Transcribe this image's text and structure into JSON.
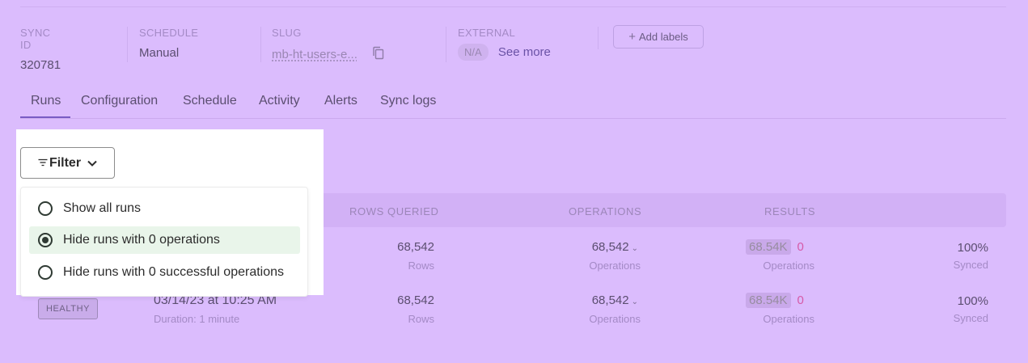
{
  "meta": {
    "sync_id": {
      "label": "SYNC ID",
      "value": "320781"
    },
    "schedule": {
      "label": "SCHEDULE",
      "value": "Manual"
    },
    "slug": {
      "label": "SLUG",
      "value": "mb-ht-users-e..."
    },
    "external": {
      "label": "EXTERNAL",
      "badge": "N/A",
      "link": "See more"
    },
    "add_labels": "Add labels"
  },
  "tabs": [
    "Runs",
    "Configuration",
    "Schedule",
    "Activity",
    "Alerts",
    "Sync logs"
  ],
  "active_tab": "Runs",
  "filter": {
    "button_label": "Filter",
    "options": [
      {
        "label": "Show all runs",
        "selected": false
      },
      {
        "label": "Hide runs with 0 operations",
        "selected": true
      },
      {
        "label": "Hide runs with 0 successful operations",
        "selected": false
      }
    ]
  },
  "table": {
    "headers": {
      "rows_queried": "ROWS QUERIED",
      "operations": "OPERATIONS",
      "results": "RESULTS"
    },
    "rows": [
      {
        "rows_value": "68,542",
        "rows_unit": "Rows",
        "ops_value": "68,542",
        "ops_unit": "Operations",
        "results_success": "68.54K",
        "results_fail": "0",
        "results_unit": "Operations",
        "synced_pct": "100%",
        "synced_label": "Synced"
      },
      {
        "status": "HEALTHY",
        "started": "03/14/23 at 10:25 AM",
        "duration": "Duration: 1 minute",
        "rows_value": "68,542",
        "rows_unit": "Rows",
        "ops_value": "68,542",
        "ops_unit": "Operations",
        "results_success": "68.54K",
        "results_fail": "0",
        "results_unit": "Operations",
        "synced_pct": "100%",
        "synced_label": "Synced"
      }
    ]
  },
  "colors": {
    "background": "#dbbcfd",
    "accent": "#7a5cc4",
    "failure": "#d65aa8",
    "selected_option": "#e9f5ea"
  }
}
